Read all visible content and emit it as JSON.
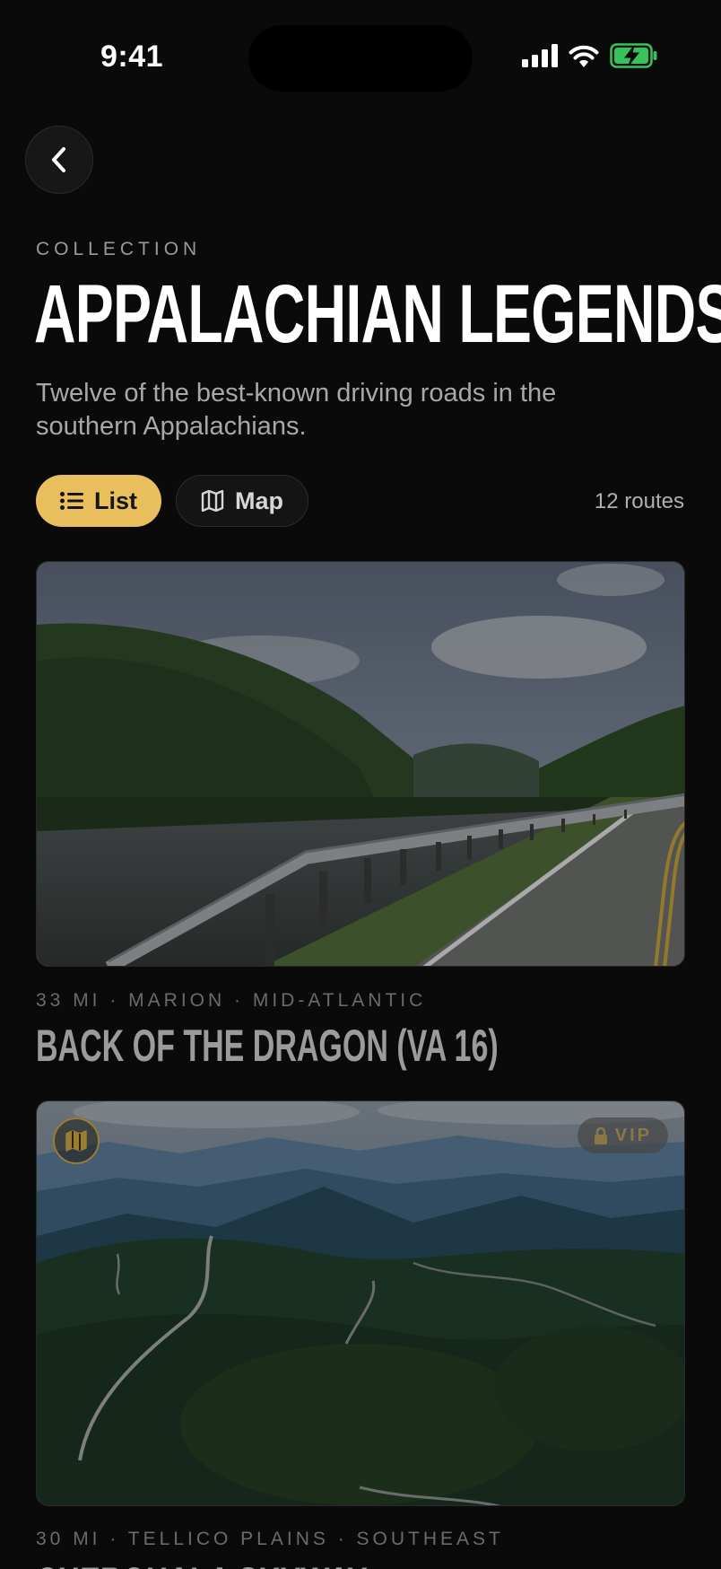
{
  "status_bar": {
    "time": "9:41"
  },
  "header": {
    "eyebrow": "COLLECTION",
    "title": "APPALACHIAN LEGENDS",
    "subtitle": "Twelve of the best-known driving roads in the southern Appalachians."
  },
  "view_toggle": {
    "list_label": "List",
    "map_label": "Map",
    "selected": "List",
    "route_count": "12 routes"
  },
  "routes": [
    {
      "meta": "33 MI · MARION · MID-ATLANTIC",
      "title": "BACK OF THE DRAGON (VA 16)"
    },
    {
      "meta": "30 MI · TELLICO PLAINS · SOUTHEAST",
      "title": "CHEROHALA SKYWAY",
      "badge": "VIP"
    }
  ],
  "colors": {
    "accent": "#e9be5c",
    "background": "#0a0a0a"
  }
}
